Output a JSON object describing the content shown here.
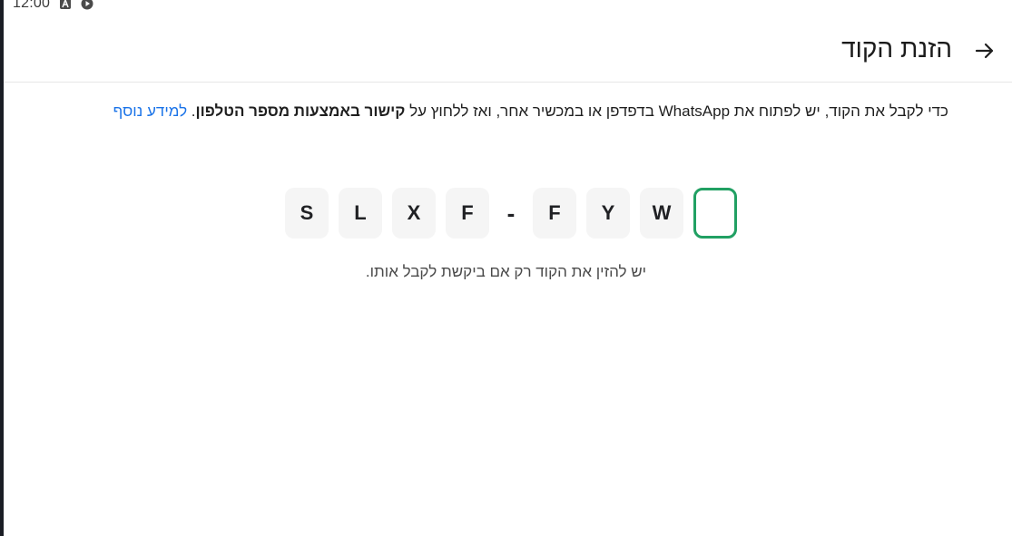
{
  "status_bar": {
    "time": "12:00",
    "icons": [
      "a-icon",
      "play-icon"
    ]
  },
  "header": {
    "title": "הזנת הקוד",
    "back_icon": "arrow-right-icon"
  },
  "instruction": {
    "part1": "כדי לקבל את הקוד, יש לפתוח את WhatsApp בדפדפן או במכשיר אחר, ואז ללחוץ על ",
    "bold": "קישור באמצעות מספר הטלפון",
    "part2": ". ",
    "link": "למידע נוסף"
  },
  "code": {
    "chars": [
      "S",
      "L",
      "X",
      "F",
      "-",
      "F",
      "Y",
      "W",
      ""
    ],
    "active_color": "#21a063"
  },
  "hint": "יש להזין את הקוד רק אם ביקשת לקבל אותו.",
  "colors": {
    "link": "#1a73e8",
    "accent": "#21a063",
    "box_bg": "#f5f5f5"
  }
}
